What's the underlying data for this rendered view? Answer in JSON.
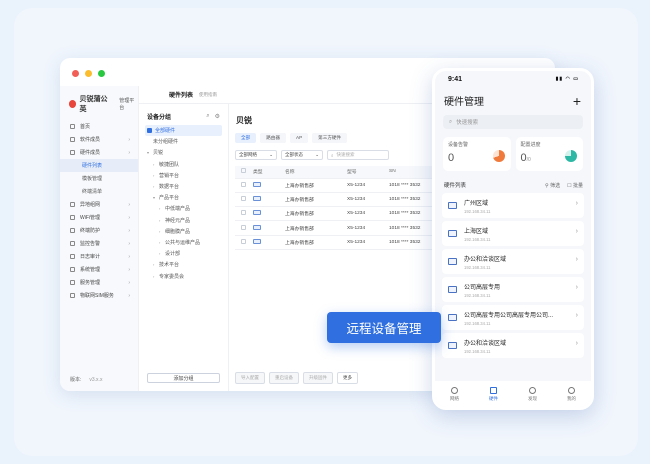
{
  "colors": {
    "accent": "#2f6fe0",
    "dot_red": "#f25f57",
    "dot_yellow": "#fbbd2e",
    "dot_green": "#28c840"
  },
  "brand": {
    "name": "贝锐蒲公英",
    "tag": "管理平台"
  },
  "topbar": {
    "title": "硬件列表",
    "sub": "使用指南"
  },
  "sidebar": {
    "items": [
      {
        "label": "首页",
        "arrow": false
      },
      {
        "label": "软件成员",
        "arrow": true
      },
      {
        "label": "硬件成员",
        "arrow": true
      },
      {
        "label": "硬件列表",
        "sub": true,
        "active": true
      },
      {
        "label": "模板管理",
        "sub": true
      },
      {
        "label": "终端清单",
        "sub": true
      },
      {
        "label": "异地组网",
        "arrow": true
      },
      {
        "label": "WiFi管理",
        "arrow": true
      },
      {
        "label": "终端防护",
        "arrow": true
      },
      {
        "label": "监控告警",
        "arrow": true
      },
      {
        "label": "日志审计",
        "arrow": true
      },
      {
        "label": "系统管理",
        "arrow": true
      },
      {
        "label": "服务管理",
        "arrow": true
      },
      {
        "label": "物联网SIM服务",
        "arrow": true
      }
    ],
    "version_label": "版本:",
    "version": "v3.x.x"
  },
  "tree": {
    "title": "设备分组",
    "add_label": "添加分组",
    "nodes": [
      {
        "label": "全部硬件",
        "indent": 0,
        "sel": true
      },
      {
        "label": "未分组硬件",
        "indent": 0
      },
      {
        "label": "贝锐",
        "indent": 0,
        "caret": "▾"
      },
      {
        "label": "敏捷团队",
        "indent": 1,
        "caret": "›"
      },
      {
        "label": "营销平台",
        "indent": 1,
        "caret": "›"
      },
      {
        "label": "数据平台",
        "indent": 1,
        "caret": "›"
      },
      {
        "label": "产品平台",
        "indent": 1,
        "caret": "▾"
      },
      {
        "label": "中低端产品",
        "indent": 2,
        "caret": "›"
      },
      {
        "label": "神经元产品",
        "indent": 2,
        "caret": "›"
      },
      {
        "label": "细胞膜产品",
        "indent": 2,
        "caret": "›"
      },
      {
        "label": "公共与运维产品",
        "indent": 2,
        "caret": "›"
      },
      {
        "label": "设计部",
        "indent": 2,
        "caret": "›"
      },
      {
        "label": "技术平台",
        "indent": 1,
        "caret": "›"
      },
      {
        "label": "专家委员会",
        "indent": 1,
        "caret": "›"
      }
    ]
  },
  "main": {
    "title": "贝锐",
    "tabs": [
      "全部",
      "路由器",
      "AP",
      "第三方硬件"
    ],
    "filters": [
      "全部网络",
      "全部状态"
    ],
    "search_placeholder": "快速搜索",
    "columns": [
      "类型",
      "名称",
      "型号",
      "SN"
    ],
    "rows": [
      {
        "name": "上海办销售部",
        "model": "X5-1234",
        "sn": "1018 **** 3532"
      },
      {
        "name": "上海办销售部",
        "model": "X5-1234",
        "sn": "1018 **** 3532"
      },
      {
        "name": "上海办销售部",
        "model": "X5-1234",
        "sn": "1018 **** 3532"
      },
      {
        "name": "上海办销售部",
        "model": "X5-1234",
        "sn": "1018 **** 3532"
      },
      {
        "name": "上海办销售部",
        "model": "X5-1234",
        "sn": "1018 **** 3532"
      }
    ],
    "bottom_buttons": [
      "导入配置",
      "重启设备",
      "升级固件",
      "更多"
    ]
  },
  "badge": "远程设备管理",
  "phone": {
    "time": "9:41",
    "title": "硬件管理",
    "plus": "+",
    "search_placeholder": "快速搜索",
    "stats": [
      {
        "label": "设备告警",
        "value": "0",
        "sub": ""
      },
      {
        "label": "配置进度",
        "value": "0",
        "sub": "/0"
      }
    ],
    "list_title": "硬件列表",
    "filter_label": "筛选",
    "batch_label": "批量",
    "items": [
      {
        "name": "广州区域",
        "ip": "192.168.34.11"
      },
      {
        "name": "上海区域",
        "ip": "192.168.34.11"
      },
      {
        "name": "办公和洽谈区域",
        "ip": "192.168.34.11"
      },
      {
        "name": "公司高层专用",
        "ip": "192.168.34.11"
      },
      {
        "name": "公司高层专用公司高层专用公司...",
        "ip": "192.168.34.11"
      },
      {
        "name": "办公和洽谈区域",
        "ip": "192.168.34.11"
      }
    ],
    "tabbar": [
      {
        "label": "网络",
        "icon": "network-icon"
      },
      {
        "label": "硬件",
        "icon": "hardware-icon",
        "on": true
      },
      {
        "label": "发现",
        "icon": "discover-icon"
      },
      {
        "label": "我的",
        "icon": "profile-icon"
      }
    ]
  }
}
